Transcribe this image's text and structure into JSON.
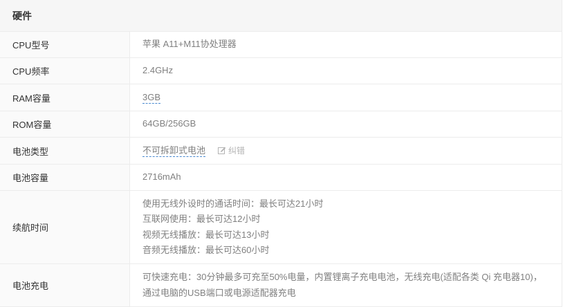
{
  "section": {
    "title": "硬件"
  },
  "rows": {
    "cpu_model": {
      "label": "CPU型号",
      "value": "苹果 A11+M11协处理器"
    },
    "cpu_freq": {
      "label": "CPU频率",
      "value": "2.4GHz"
    },
    "ram": {
      "label": "RAM容量",
      "value": "3GB"
    },
    "rom": {
      "label": "ROM容量",
      "value": "64GB/256GB"
    },
    "battery_type": {
      "label": "电池类型",
      "value": "不可拆卸式电池",
      "correct_label": "纠错",
      "correct_icon": "edit-icon"
    },
    "battery_capacity": {
      "label": "电池容量",
      "value": "2716mAh"
    },
    "endurance": {
      "label": "续航时间",
      "lines": [
        "使用无线外设时的通话时间：最长可达21小时",
        "互联网使用：最长可达12小时",
        "视频无线播放：最长可达13小时",
        "音频无线播放：最长可达60小时"
      ]
    },
    "charging": {
      "label": "电池充电",
      "lines": [
        "可快速充电：30分钟最多可充至50%电量，内置锂离子充电电池，无线充电(适配各类 Qi 充电器10)，",
        "通过电脑的USB端口或电源适配器充电"
      ]
    }
  },
  "colors": {
    "header_bg": "#f6f6f6",
    "label_bg": "#fafafa",
    "border": "#ececec",
    "link_underline": "#4a8ad0"
  }
}
